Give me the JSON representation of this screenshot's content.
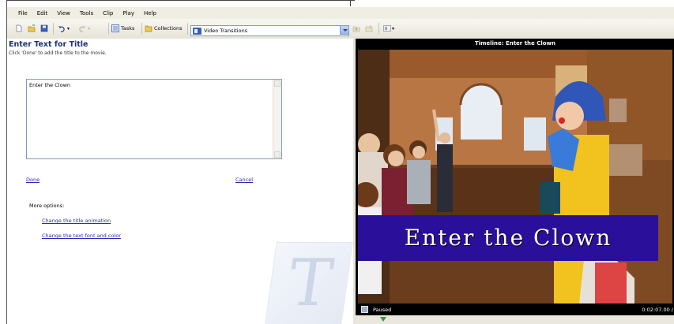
{
  "menu": [
    "File",
    "Edit",
    "View",
    "Tools",
    "Clip",
    "Play",
    "Help"
  ],
  "toolbar": {
    "tasks_label": "Tasks",
    "collections_label": "Collections",
    "collection_value": "Video Transitions"
  },
  "task": {
    "title": "Enter Text for Title",
    "instruction": "Click 'Done' to add the title to the movie.",
    "title_text": "Enter the Clown",
    "done_label": "Done",
    "cancel_label": "Cancel",
    "more_options_label": "More options:",
    "option_links": [
      "Change the title animation",
      "Change the text font and color"
    ]
  },
  "monitor": {
    "title": "Timeline: Enter the Clown",
    "overlay_text": "Enter the Clown",
    "status": "Paused",
    "time": "0:02:07.00 /"
  },
  "colors": {
    "accent": "#1d3371",
    "link": "#2b2bb3",
    "banner": "#2a0f9a"
  }
}
